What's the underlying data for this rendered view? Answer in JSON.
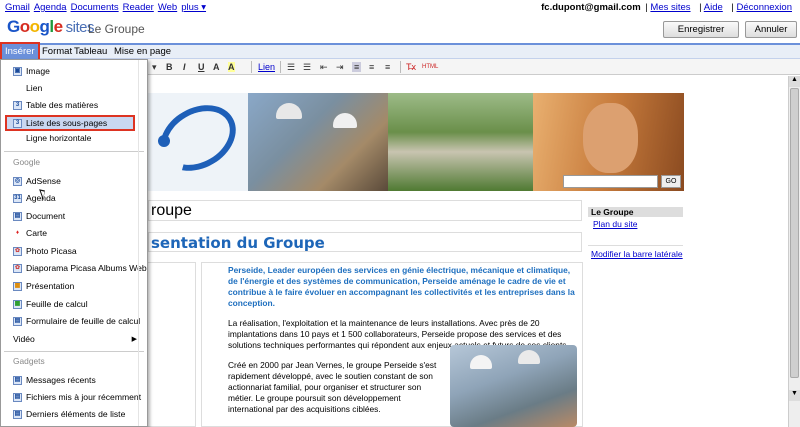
{
  "gbar": {
    "links": [
      "Gmail",
      "Agenda",
      "Documents",
      "Reader",
      "Web",
      "plus ▾"
    ],
    "email": "fc.dupont@gmail.com",
    "right_links": [
      "Mes sites",
      "Aide",
      "Déconnexion"
    ],
    "sep": "|"
  },
  "header": {
    "logo_google": [
      "G",
      "o",
      "o",
      "g",
      "l",
      "e"
    ],
    "logo_sites": "sites",
    "site_name": "Le Groupe",
    "save": "Enregistrer",
    "cancel": "Annuler"
  },
  "menubar": {
    "inserer": "Insérer",
    "format": "Format",
    "tableau": "Tableau",
    "mise": "Mise en page"
  },
  "toolbar": {
    "dropdown": "▾",
    "bold": "B",
    "italic": "I",
    "underline": "U",
    "color_a": "A",
    "bg_color": "A",
    "lien": "Lien",
    "list_num": "☰",
    "list_bul": "☰",
    "indent_less": "⇤",
    "indent_more": "⇥",
    "align_left": "≡",
    "align_center": "≡",
    "align_right": "≡",
    "clear": "T̶x",
    "html": "HTML"
  },
  "dropdown": {
    "items": [
      {
        "label": "Image",
        "icon": "▣"
      },
      {
        "label": "Lien",
        "icon": ""
      },
      {
        "label": "Table des matières",
        "icon": "3"
      },
      {
        "label": "Liste des sous-pages",
        "icon": "3"
      },
      {
        "label": "Ligne horizontale",
        "icon": ""
      }
    ],
    "section_google": "Google",
    "google_items": [
      {
        "label": "AdSense",
        "icon": "◎"
      },
      {
        "label": "Agenda",
        "icon": "31"
      },
      {
        "label": "Document",
        "icon": "▤"
      },
      {
        "label": "Carte",
        "icon": "♦"
      },
      {
        "label": "Photo Picasa",
        "icon": "✿"
      },
      {
        "label": "Diaporama Picasa Albums Web",
        "icon": "✿"
      },
      {
        "label": "Présentation",
        "icon": "▦"
      },
      {
        "label": "Feuille de calcul",
        "icon": "▦"
      },
      {
        "label": "Formulaire de feuille de calcul",
        "icon": "▤"
      },
      {
        "label": "Vidéo",
        "icon": "",
        "arrow": "▶"
      }
    ],
    "section_gadgets": "Gadgets",
    "gadget_items": [
      {
        "label": "Messages récents",
        "icon": "▤"
      },
      {
        "label": "Fichiers mis à jour récemment",
        "icon": "▤"
      },
      {
        "label": "Derniers éléments de liste",
        "icon": "▤"
      }
    ]
  },
  "page": {
    "title": "roupe",
    "subtitle": "sentation du Groupe",
    "search_button": "GO",
    "lead": "Perseide, Leader européen des services en génie électrique, mécanique et climatique, de l'énergie et des systèmes de communication, Perseide aménage le cadre de vie et contribue à le faire évoluer en accompagnant les collectivités et les entreprises dans la conception.",
    "para2": "La réalisation, l'exploitation et la maintenance de leurs installations. Avec près de 20 implantations dans 10 pays et 1 500 collaborateurs, Perseide propose des services et des solutions techniques performantes qui répondent aux enjeux actuels et futurs de ses clients.",
    "para3": "Créé en 2000 par Jean Vernes, le groupe Perseide s'est rapidement développé, avec le soutien constant de son actionnariat familial, pour organiser et structurer son métier. Le groupe poursuit son développement international par des acquisitions ciblées."
  },
  "sidebar": {
    "heading": "Le Groupe",
    "link": "Plan du site",
    "modify": "Modifier la barre latérale"
  },
  "colors": {
    "menu_active": "#6b90da",
    "highlight_outline": "#dd3322",
    "lead_text": "#1e6fbf",
    "subtitle": "#1e66b8"
  }
}
